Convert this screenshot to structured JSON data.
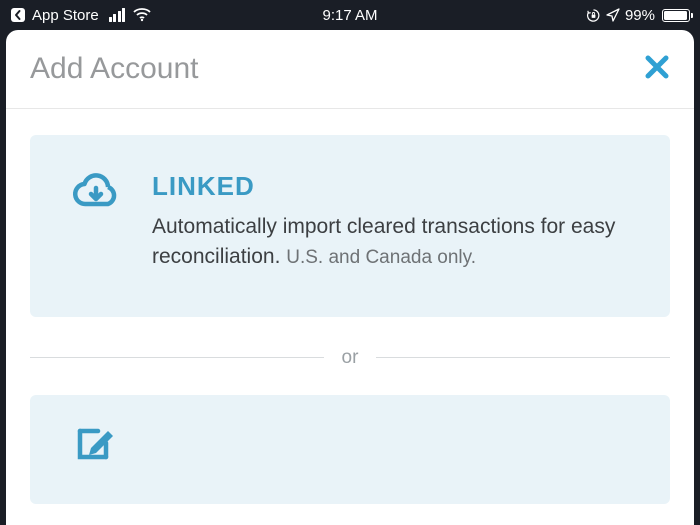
{
  "statusBar": {
    "backLabel": "App Store",
    "time": "9:17 AM",
    "batteryPercent": "99%"
  },
  "header": {
    "title": "Add Account"
  },
  "options": {
    "linked": {
      "title": "LINKED",
      "desc": "Automatically import cleared transactions for easy reconciliation.",
      "sub": "U.S. and Canada only."
    }
  },
  "dividerText": "or",
  "icons": {
    "cloudDownload": "cloud-download-icon",
    "edit": "edit-icon",
    "close": "close-icon"
  },
  "colors": {
    "accent": "#3a9ac4",
    "cardBg": "#e9f3f8"
  }
}
